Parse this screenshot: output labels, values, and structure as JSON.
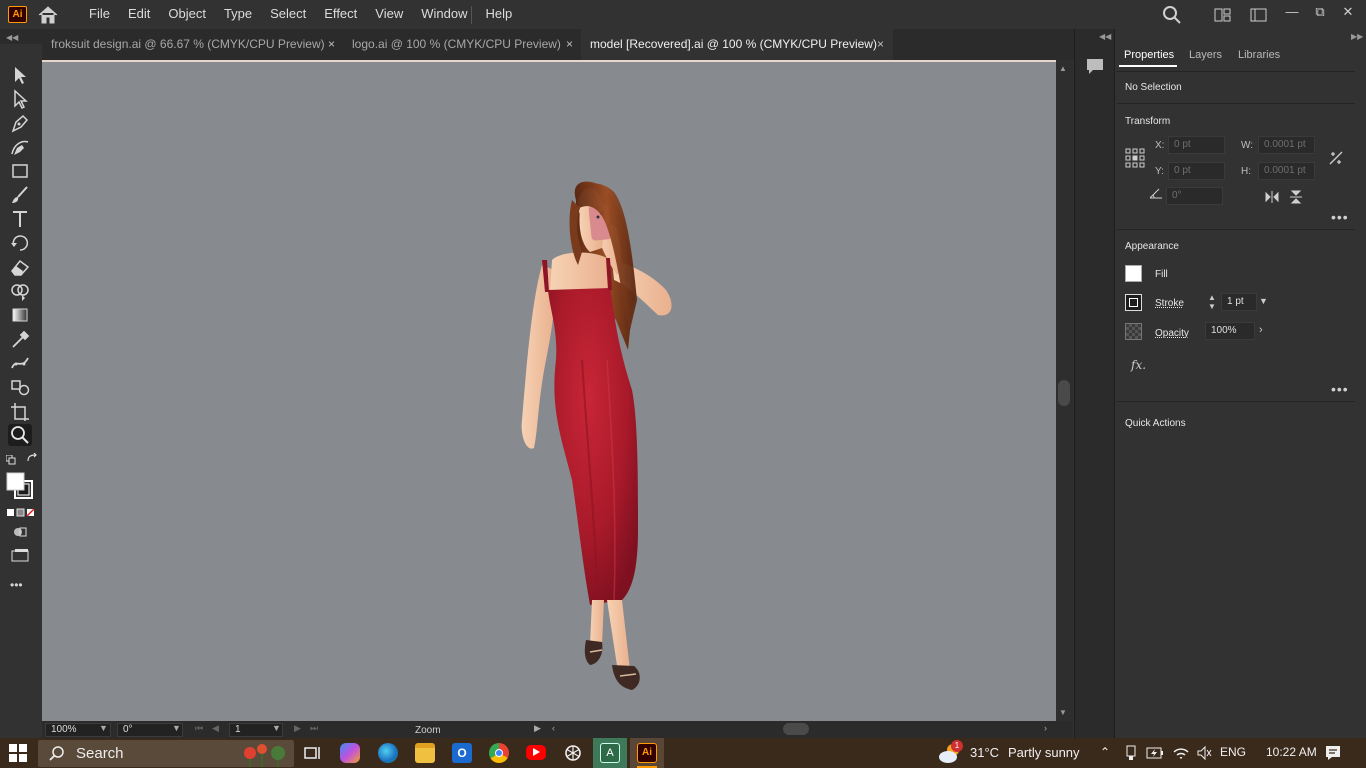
{
  "app": {
    "logo_text": "Ai"
  },
  "menu": [
    "File",
    "Edit",
    "Object",
    "Type",
    "Select",
    "Effect",
    "View",
    "Window",
    "Help"
  ],
  "window_controls": {
    "minimize": "—",
    "restore": "⧉",
    "close": "✕"
  },
  "tabs": [
    {
      "label": "froksuit design.ai @ 66.67 % (CMYK/CPU Preview)",
      "close": "×"
    },
    {
      "label": "logo.ai @ 100 % (CMYK/CPU Preview)",
      "close": "×"
    },
    {
      "label": "model [Recovered].ai @ 100 % (CMYK/CPU Preview)",
      "close": "×",
      "active": true
    }
  ],
  "toolbar": {
    "tools": [
      "selection-tool",
      "direct-selection-tool",
      "pen-tool",
      "curvature-tool",
      "rectangle-tool",
      "paintbrush-tool",
      "type-tool",
      "rotate-tool",
      "eraser-tool",
      "shape-builder-tool",
      "gradient-tool",
      "eyedropper-tool",
      "puppet-warp-tool",
      "blend-tool",
      "artboard-tool",
      "zoom-tool"
    ],
    "selected": "zoom-tool",
    "more": "•••"
  },
  "statusbar": {
    "zoom": "100%",
    "rotation": "0°",
    "artboard": "1",
    "tool_name": "Zoom"
  },
  "properties": {
    "tabs": [
      "Properties",
      "Layers",
      "Libraries"
    ],
    "selection": "No Selection",
    "transform": {
      "title": "Transform",
      "x_label": "X:",
      "x_value": "0 pt",
      "y_label": "Y:",
      "y_value": "0 pt",
      "w_label": "W:",
      "w_value": "0.0001 pt",
      "h_label": "H:",
      "h_value": "0.0001 pt",
      "angle": "0°"
    },
    "appearance": {
      "title": "Appearance",
      "fill_label": "Fill",
      "stroke_label": "Stroke",
      "stroke_weight": "1 pt",
      "opacity_label": "Opacity",
      "opacity_value": "100%",
      "fx_label": "fx."
    },
    "quick_actions": "Quick Actions",
    "more": "•••"
  },
  "taskbar": {
    "search_label": "Search",
    "weather_temp": "31°C",
    "weather_text": "Partly sunny",
    "weather_badge": "1",
    "language": "ENG",
    "time": "10:22 AM"
  },
  "colors": {
    "canvas": "#878a8f",
    "dress": "#b51f2e",
    "hair": "#7a3b1c",
    "skin": "#f2c7a6",
    "accent_ai": "#ff9a00"
  }
}
